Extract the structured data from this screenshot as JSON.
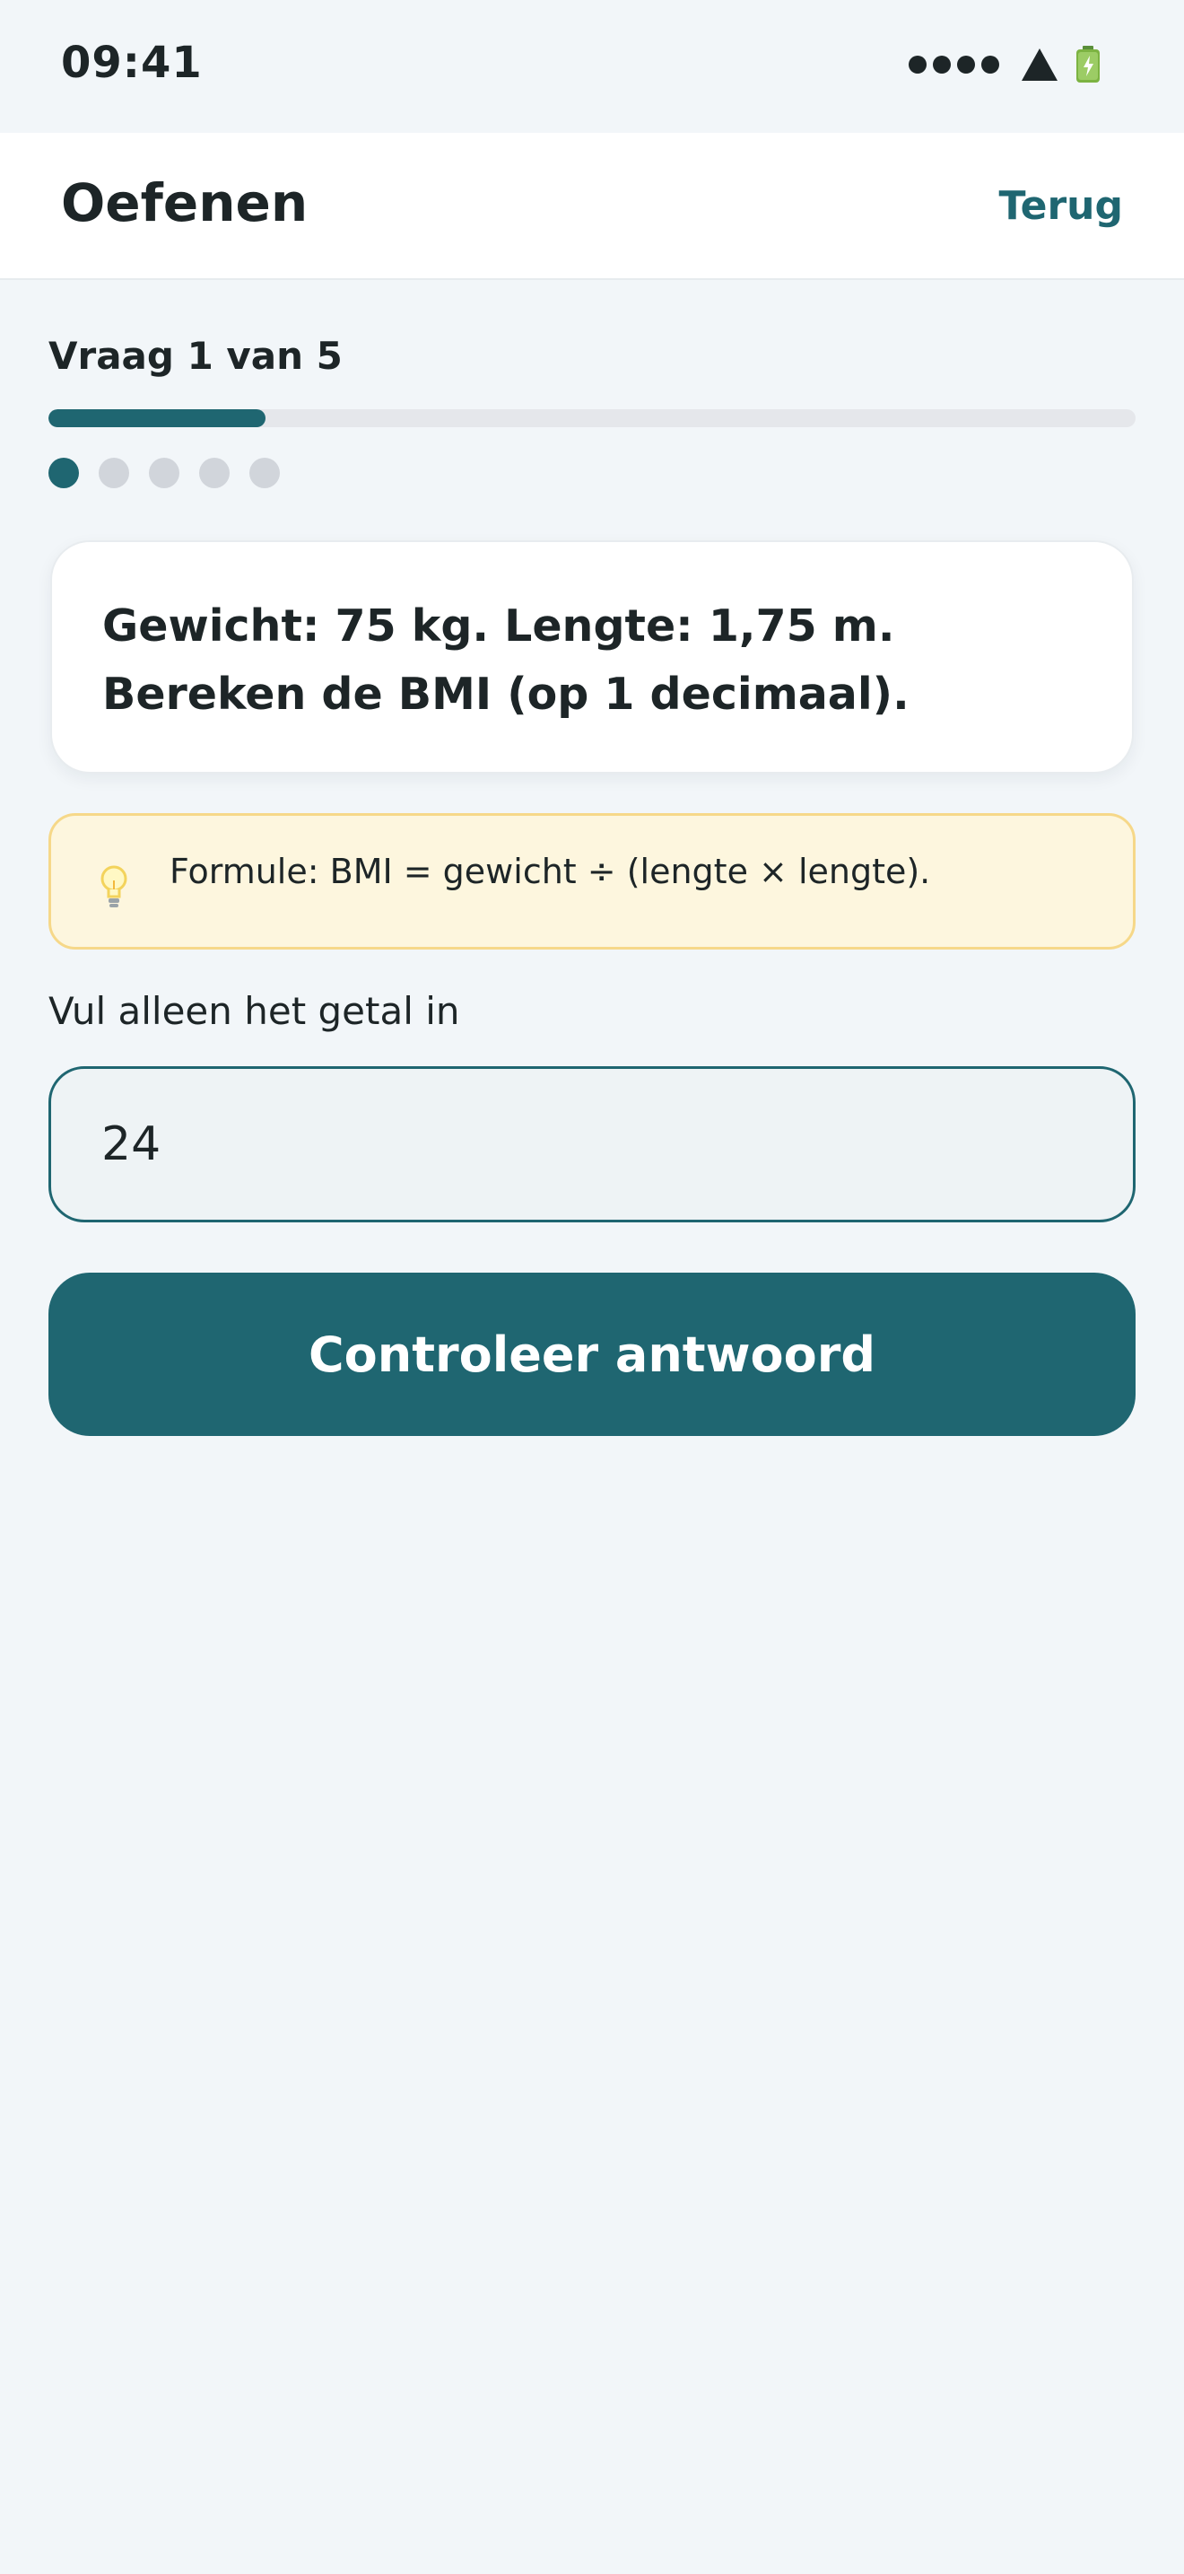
{
  "status_bar": {
    "time": "09:41"
  },
  "header": {
    "title": "Oefenen",
    "back_label": "Terug"
  },
  "progress": {
    "counter_text": "Vraag 1 van 5",
    "current": 1,
    "total": 5,
    "fraction": 0.2
  },
  "question": {
    "line1": "Gewicht: 75 kg. Lengte: 1,75 m.",
    "line2": "Bereken de BMI (op 1 decimaal)."
  },
  "hint": {
    "icon": "lightbulb-icon",
    "text": "Formule: BMI = gewicht ÷ (lengte × lengte)."
  },
  "answer": {
    "label": "Vul alleen het getal in",
    "value": "24"
  },
  "submit": {
    "label": "Controleer antwoord"
  },
  "colors": {
    "accent": "#1f6671",
    "background": "#f2f6f9",
    "hint_background": "#fdf6de",
    "hint_border": "#f6d889",
    "inactive_dot": "#d1d5db"
  }
}
